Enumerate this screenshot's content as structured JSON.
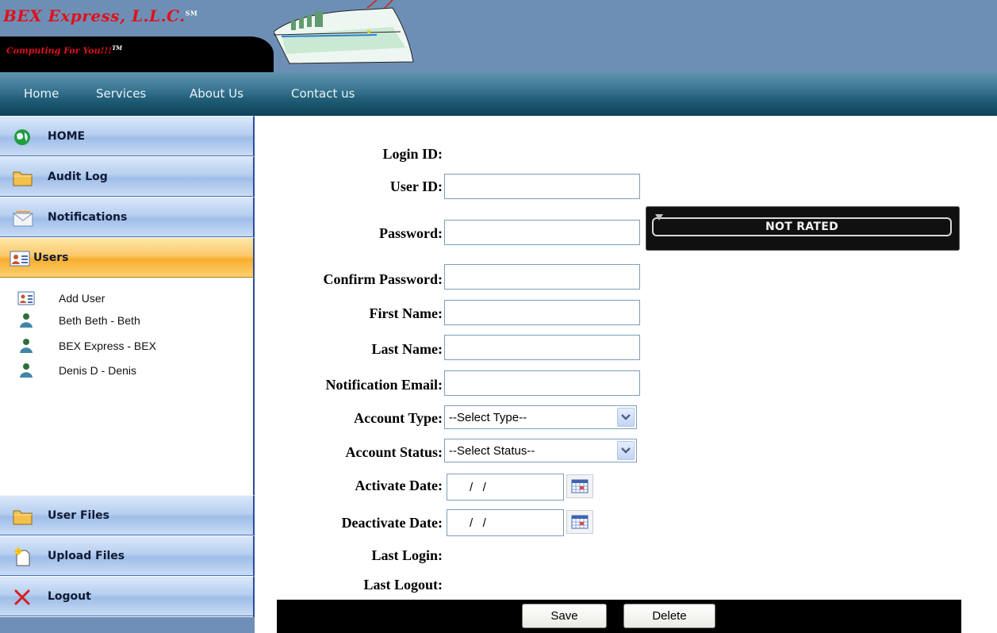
{
  "brand": {
    "name": "BEX Express, L.L.C.",
    "trademark": "SM",
    "tagline": "Computing For You!!!",
    "tagline_mark": "TM"
  },
  "nav": {
    "items": [
      {
        "label": "Home"
      },
      {
        "label": "Services"
      },
      {
        "label": "About Us"
      },
      {
        "label": "Contact us"
      }
    ]
  },
  "sidebar": {
    "top_items": [
      {
        "label": "HOME",
        "icon": "globe-icon"
      },
      {
        "label": "Audit Log",
        "icon": "folder-icon"
      },
      {
        "label": "Notifications",
        "icon": "envelope-icon"
      },
      {
        "label": "Users",
        "icon": "user-card-icon",
        "active": true
      }
    ],
    "sub_items": [
      {
        "label": "Add User",
        "icon": "user-card-icon"
      },
      {
        "label": "Beth Beth - Beth",
        "icon": "person-icon"
      },
      {
        "label": "BEX Express - BEX",
        "icon": "person-icon"
      },
      {
        "label": "Denis D - Denis",
        "icon": "person-icon"
      }
    ],
    "bottom_items": [
      {
        "label": "User Files",
        "icon": "folder-icon"
      },
      {
        "label": "Upload Files",
        "icon": "new-file-icon"
      },
      {
        "label": "Logout",
        "icon": "red-x-icon"
      }
    ]
  },
  "form": {
    "login_id_label": "Login ID:",
    "user_id_label": "User ID:",
    "password_label": "Password:",
    "confirm_password_label": "Confirm Password:",
    "first_name_label": "First Name:",
    "last_name_label": "Last Name:",
    "notification_email_label": "Notification Email:",
    "account_type_label": "Account Type:",
    "account_type_value": "--Select Type--",
    "account_status_label": "Account Status:",
    "account_status_value": "--Select Status--",
    "activate_date_label": "Activate Date:",
    "activate_date_value": "/   /",
    "deactivate_date_label": "Deactivate Date:",
    "deactivate_date_value": "/   /",
    "last_login_label": "Last Login:",
    "last_logout_label": "Last Logout:",
    "password_strength": "NOT RATED"
  },
  "actions": {
    "save_label": "Save",
    "delete_label": "Delete"
  }
}
